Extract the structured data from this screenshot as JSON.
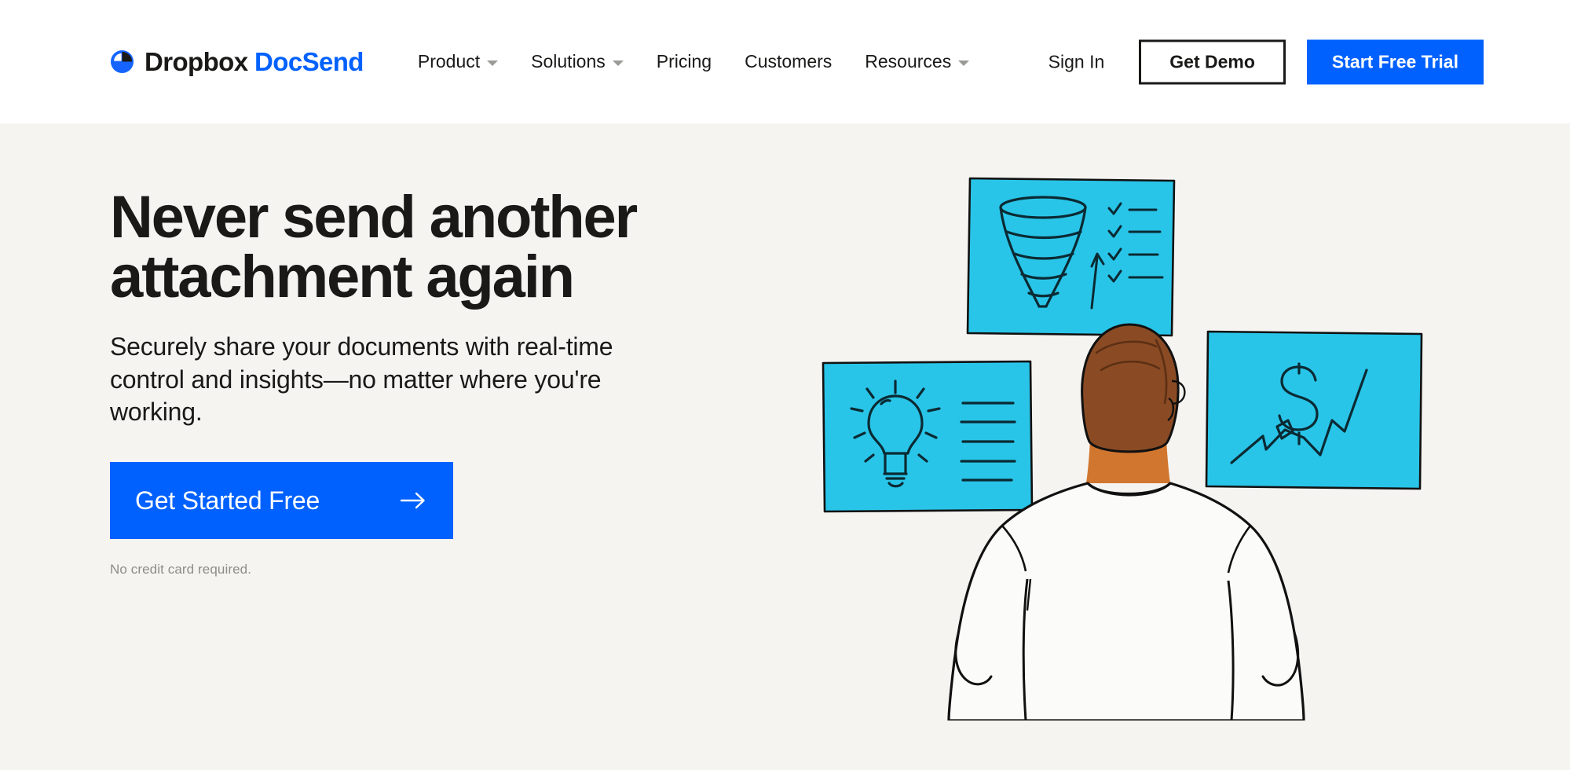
{
  "brand": {
    "logo_icon": "dropbox-logo-icon",
    "name_primary": "Dropbox",
    "name_secondary": "DocSend"
  },
  "nav": {
    "items": [
      {
        "label": "Product",
        "has_dropdown": true,
        "icon": "chevron-down-icon"
      },
      {
        "label": "Solutions",
        "has_dropdown": true,
        "icon": "chevron-down-icon"
      },
      {
        "label": "Pricing",
        "has_dropdown": false,
        "icon": ""
      },
      {
        "label": "Customers",
        "has_dropdown": false,
        "icon": ""
      },
      {
        "label": "Resources",
        "has_dropdown": true,
        "icon": "chevron-down-icon"
      }
    ]
  },
  "header_actions": {
    "sign_in": "Sign In",
    "get_demo": "Get Demo",
    "start_free_trial": "Start Free Trial"
  },
  "hero": {
    "title": "Never send another attachment again",
    "subtitle": "Securely share your documents with real-time control and insights—no matter where you're working.",
    "cta_label": "Get Started Free",
    "cta_icon": "arrow-right-icon",
    "note": "No credit card required.",
    "illustration": {
      "name": "person-viewing-insight-cards-illustration",
      "cards": [
        {
          "name": "funnel-checklist-card",
          "icons": [
            "funnel-icon",
            "up-arrow-icon",
            "checklist-icon"
          ]
        },
        {
          "name": "lightbulb-idea-card",
          "icons": [
            "lightbulb-icon",
            "text-lines-icon"
          ]
        },
        {
          "name": "revenue-growth-card",
          "icons": [
            "dollar-sign-icon",
            "trend-line-icon"
          ]
        }
      ],
      "figure": "person-back-view"
    }
  },
  "colors": {
    "brand_blue": "#0061FF",
    "card_cyan": "#29c5e8",
    "hero_background": "#f5f4f1",
    "header_background": "#ffffff",
    "text_primary": "#1a1918",
    "text_muted": "#8d8d87",
    "hair_brown": "#8a4b24",
    "skin": "#d1762f"
  }
}
